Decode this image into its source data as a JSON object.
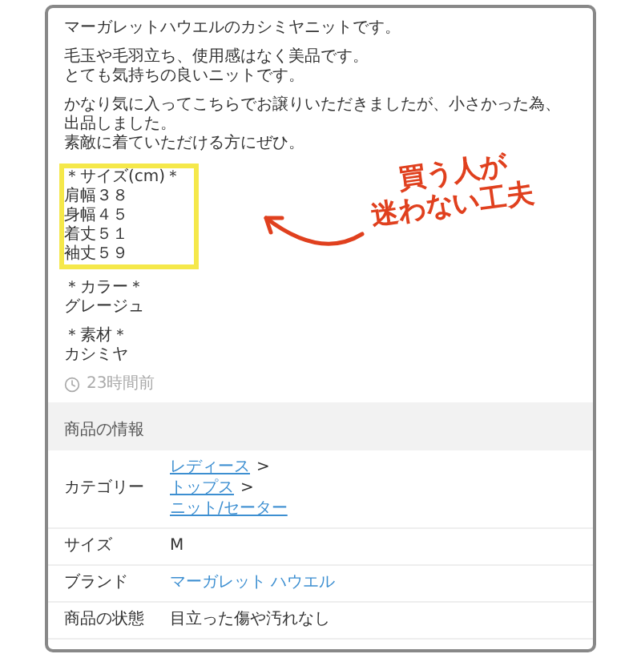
{
  "description": {
    "blocks": [
      {
        "lines": [
          "マーガレットハウエルのカシミヤニットです。"
        ],
        "highlighted": false
      },
      {
        "lines": [
          "毛玉や毛羽立ち、使用感はなく美品です。",
          "とても気持ちの良いニットです。"
        ],
        "highlighted": false
      },
      {
        "lines": [
          "かなり気に入ってこちらでお譲りいただきましたが、小さかった為、",
          "出品しました。",
          "素敵に着ていただける方にぜひ。"
        ],
        "highlighted": false
      },
      {
        "lines": [
          "＊サイズ(cm)＊",
          "肩幅３８",
          "身幅４５",
          "着丈５１",
          "袖丈５９"
        ],
        "highlighted": true
      },
      {
        "lines": [
          "＊カラー＊",
          "グレージュ"
        ],
        "highlighted": false
      },
      {
        "lines": [
          "＊素材＊",
          "カシミヤ"
        ],
        "highlighted": false
      }
    ],
    "timestamp": "23時間前"
  },
  "annotation": {
    "lines": [
      "買う人が",
      "迷わない工夫"
    ]
  },
  "product_info": {
    "title": "商品の情報",
    "rows": [
      {
        "label": "カテゴリー",
        "kind": "links",
        "links": [
          {
            "text": "レディース",
            "separator": ">"
          },
          {
            "text": "トップス",
            "separator": ">"
          },
          {
            "text": "ニット/セーター"
          }
        ]
      },
      {
        "label": "サイズ",
        "kind": "text",
        "value": "M"
      },
      {
        "label": "ブランド",
        "kind": "link",
        "value": "マーガレット ハウエル"
      },
      {
        "label": "商品の状態",
        "kind": "text",
        "value": "目立った傷や汚れなし"
      }
    ]
  }
}
